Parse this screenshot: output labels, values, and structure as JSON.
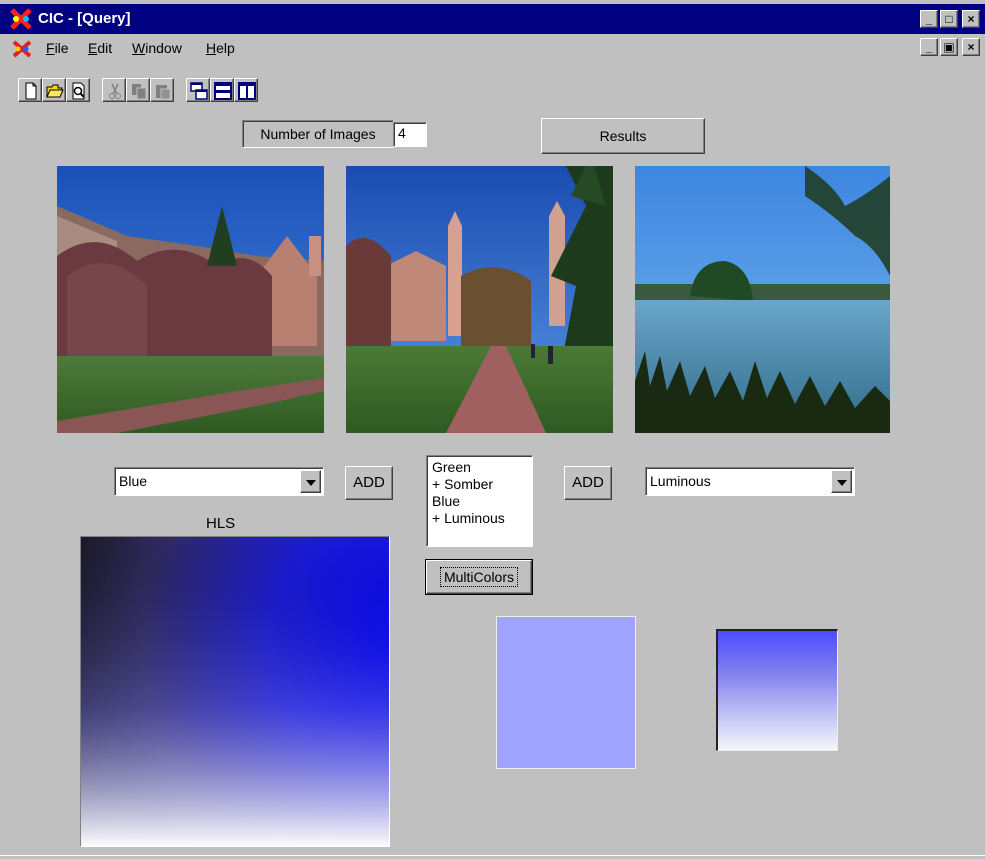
{
  "window": {
    "title": "CIC - [Query]",
    "controls": {
      "minimize": "_",
      "maximize": "□",
      "close": "×"
    },
    "child_controls": {
      "minimize": "_",
      "restore": "▣",
      "close": "×"
    }
  },
  "menu": {
    "file": "File",
    "edit": "Edit",
    "window": "Window",
    "help": "Help"
  },
  "toolbar": {
    "icons": [
      "new-file-icon",
      "open-folder-icon",
      "print-preview-icon",
      "cut-icon",
      "copy-icon",
      "paste-icon",
      "cascade-icon",
      "tile-horizontal-icon",
      "tile-vertical-icon"
    ]
  },
  "query": {
    "num_images_label": "Number of Images",
    "num_images_value": "4",
    "results_label": "Results"
  },
  "left_color": {
    "selected": "Blue",
    "add_label": "ADD"
  },
  "right_color": {
    "selected": "Luminous",
    "add_label": "ADD"
  },
  "color_list": {
    "items": [
      "Green",
      "+ Somber",
      "Blue",
      "+ Luminous"
    ]
  },
  "multicolors_label": "MultiColors",
  "hls_label": "HLS",
  "colors": {
    "titlebar": "#000080",
    "face": "#c0c0c0",
    "swatch_a": "#a0a4ff"
  }
}
